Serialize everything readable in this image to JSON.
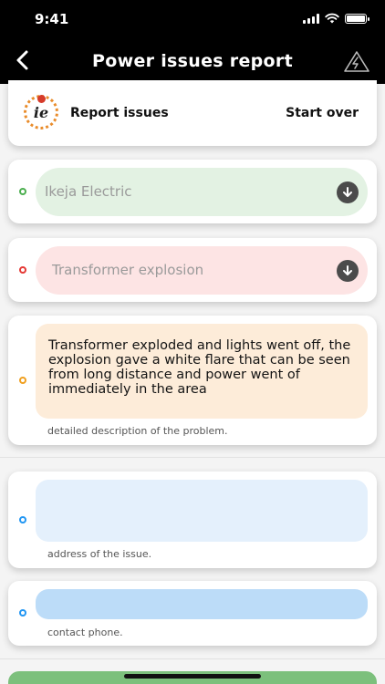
{
  "status_bar": {
    "time": "9:41"
  },
  "nav": {
    "title": "Power issues report",
    "back_icon": "chevron-left-icon",
    "action_icon": "warning-triangle-icon"
  },
  "header_card": {
    "logo_text": "ie",
    "label": "Report issues",
    "start_over": "Start over"
  },
  "provider": {
    "value": "Ikeja Electric",
    "indicator_color": "#4caf50",
    "fill_color": "#e3f2e3"
  },
  "issue_type": {
    "value": "Transformer explosion",
    "indicator_color": "#e53935",
    "fill_color": "#fde4e4"
  },
  "description": {
    "value": "Transformer exploded and lights went off, the explosion gave a white flare that can be seen from long distance and power went of immediately in the area",
    "hint": "detailed description of the problem.",
    "indicator_color": "#f0a020",
    "fill_color": "#fdecd9"
  },
  "address": {
    "value": "",
    "hint": "address of the issue.",
    "indicator_color": "#2196f3",
    "fill_color": "#e4f0fc"
  },
  "phone": {
    "value": "",
    "hint": "contact phone.",
    "indicator_color": "#2196f3",
    "fill_color": "#bcdcf8"
  },
  "colors": {
    "header_bg": "#000000",
    "submit_green": "#7cc07c"
  }
}
